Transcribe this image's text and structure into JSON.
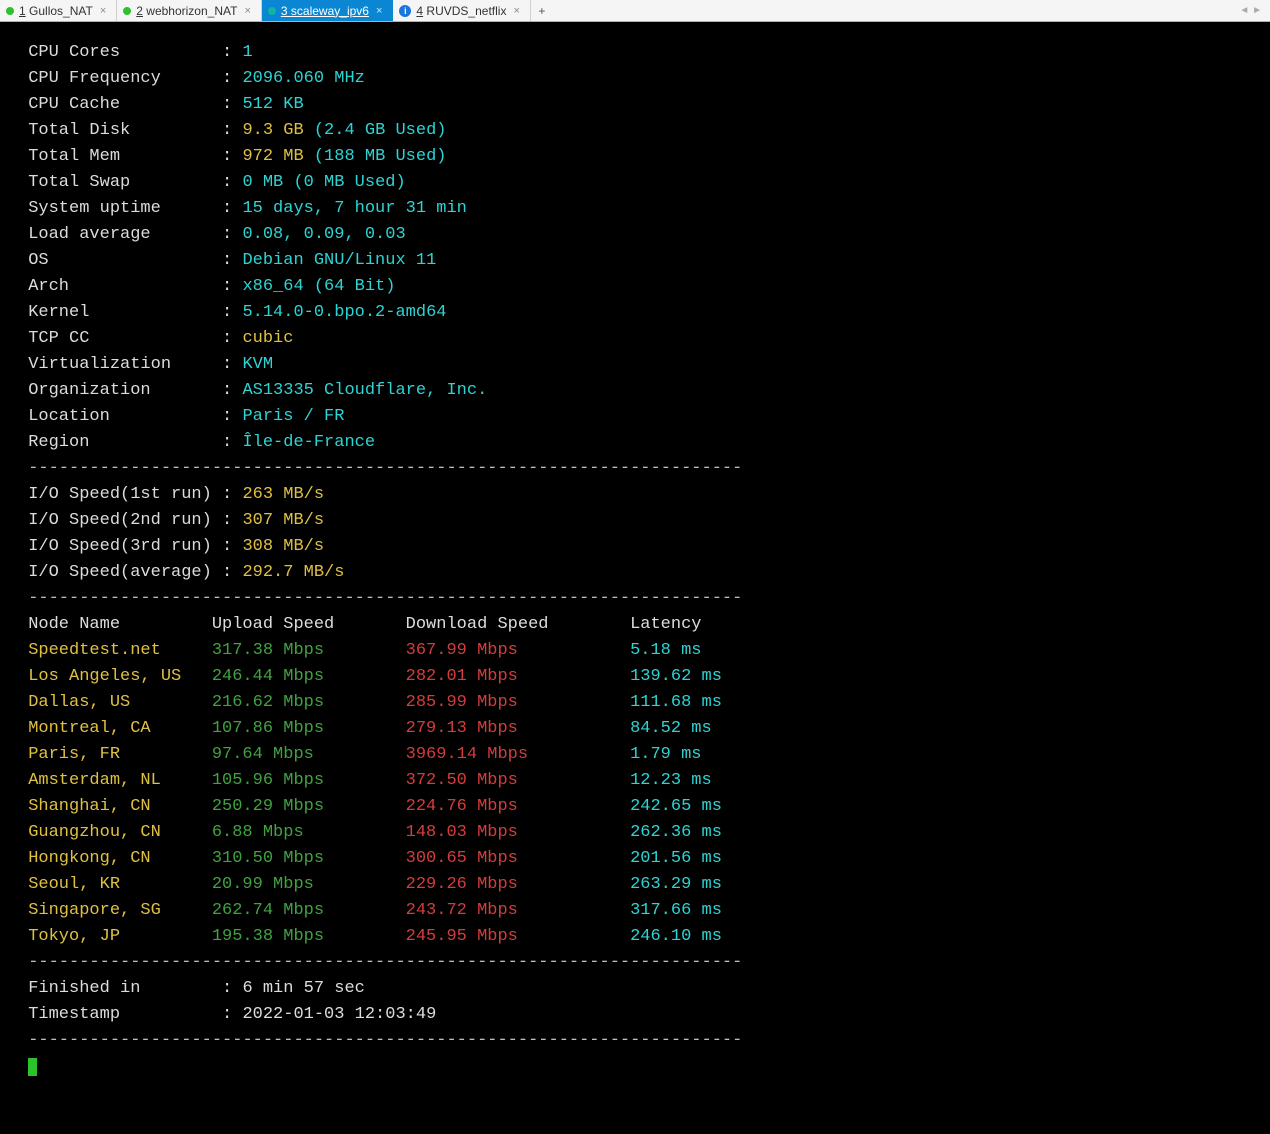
{
  "tabs": [
    {
      "index": "1",
      "label": "Gullos_NAT",
      "dot": "green",
      "active": false
    },
    {
      "index": "2",
      "label": "webhorizon_NAT",
      "dot": "green",
      "active": false
    },
    {
      "index": "3",
      "label": "scaleway_ipv6",
      "dot": "teal",
      "active": true
    },
    {
      "index": "4",
      "label": "RUVDS_netflix",
      "dot": "info",
      "active": false
    }
  ],
  "newtab_label": "+",
  "dash_line": "----------------------------------------------------------------------",
  "sysinfo": [
    {
      "label": "CPU Cores",
      "value": "1",
      "cls": "cyan"
    },
    {
      "label": "CPU Frequency",
      "value": "2096.060 MHz",
      "cls": "cyan"
    },
    {
      "label": "CPU Cache",
      "value": "512 KB",
      "cls": "cyan"
    },
    {
      "label": "Total Disk",
      "value": "9.3 GB",
      "extra": "(2.4 GB Used)",
      "cls": "yellow"
    },
    {
      "label": "Total Mem",
      "value": "972 MB",
      "extra": "(188 MB Used)",
      "cls": "yellow"
    },
    {
      "label": "Total Swap",
      "value": "0 MB",
      "extra": "(0 MB Used)",
      "cls": "cyan"
    },
    {
      "label": "System uptime",
      "value": "15 days, 7 hour 31 min",
      "cls": "cyan"
    },
    {
      "label": "Load average",
      "value": "0.08, 0.09, 0.03",
      "cls": "cyan"
    },
    {
      "label": "OS",
      "value": "Debian GNU/Linux 11",
      "cls": "cyan"
    },
    {
      "label": "Arch",
      "value": "x86_64 (64 Bit)",
      "cls": "cyan"
    },
    {
      "label": "Kernel",
      "value": "5.14.0-0.bpo.2-amd64",
      "cls": "cyan"
    },
    {
      "label": "TCP CC",
      "value": "cubic",
      "cls": "yellow"
    },
    {
      "label": "Virtualization",
      "value": "KVM",
      "cls": "cyan"
    },
    {
      "label": "Organization",
      "value": "AS13335 Cloudflare, Inc.",
      "cls": "cyan"
    },
    {
      "label": "Location",
      "value": "Paris / FR",
      "cls": "cyan"
    },
    {
      "label": "Region",
      "value": "Île-de-France",
      "cls": "cyan"
    }
  ],
  "io": [
    {
      "label": "I/O Speed(1st run)",
      "value": "263 MB/s"
    },
    {
      "label": "I/O Speed(2nd run)",
      "value": "307 MB/s"
    },
    {
      "label": "I/O Speed(3rd run)",
      "value": "308 MB/s"
    },
    {
      "label": "I/O Speed(average)",
      "value": "292.7 MB/s"
    }
  ],
  "speed_header": {
    "node": "Node Name",
    "up": "Upload Speed",
    "dn": "Download Speed",
    "lat": "Latency"
  },
  "speeds": [
    {
      "node": "Speedtest.net",
      "up": "317.38 Mbps",
      "dn": "367.99 Mbps",
      "lat": "5.18 ms"
    },
    {
      "node": "Los Angeles, US",
      "up": "246.44 Mbps",
      "dn": "282.01 Mbps",
      "lat": "139.62 ms"
    },
    {
      "node": "Dallas, US",
      "up": "216.62 Mbps",
      "dn": "285.99 Mbps",
      "lat": "111.68 ms"
    },
    {
      "node": "Montreal, CA",
      "up": "107.86 Mbps",
      "dn": "279.13 Mbps",
      "lat": "84.52 ms"
    },
    {
      "node": "Paris, FR",
      "up": "97.64 Mbps",
      "dn": "3969.14 Mbps",
      "lat": "1.79 ms"
    },
    {
      "node": "Amsterdam, NL",
      "up": "105.96 Mbps",
      "dn": "372.50 Mbps",
      "lat": "12.23 ms"
    },
    {
      "node": "Shanghai, CN",
      "up": "250.29 Mbps",
      "dn": "224.76 Mbps",
      "lat": "242.65 ms"
    },
    {
      "node": "Guangzhou, CN",
      "up": "6.88 Mbps",
      "dn": "148.03 Mbps",
      "lat": "262.36 ms"
    },
    {
      "node": "Hongkong, CN",
      "up": "310.50 Mbps",
      "dn": "300.65 Mbps",
      "lat": "201.56 ms"
    },
    {
      "node": "Seoul, KR",
      "up": "20.99 Mbps",
      "dn": "229.26 Mbps",
      "lat": "263.29 ms"
    },
    {
      "node": "Singapore, SG",
      "up": "262.74 Mbps",
      "dn": "243.72 Mbps",
      "lat": "317.66 ms"
    },
    {
      "node": "Tokyo, JP",
      "up": "195.38 Mbps",
      "dn": "245.95 Mbps",
      "lat": "246.10 ms"
    }
  ],
  "footer": [
    {
      "label": "Finished in",
      "value": "6 min 57 sec"
    },
    {
      "label": "Timestamp",
      "value": "2022-01-03 12:03:49"
    }
  ]
}
